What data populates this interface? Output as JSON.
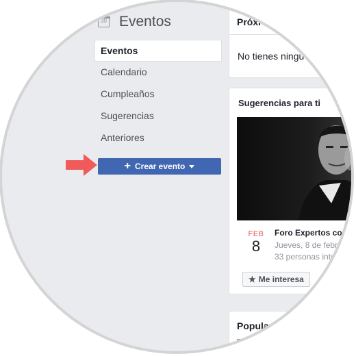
{
  "header": {
    "title": "Eventos",
    "calendar_icon_text": "30"
  },
  "sidebar": {
    "items": [
      {
        "label": "Eventos",
        "active": true
      },
      {
        "label": "Calendario"
      },
      {
        "label": "Cumpleaños"
      },
      {
        "label": "Sugerencias"
      },
      {
        "label": "Anteriores"
      }
    ],
    "create_button": {
      "label": "Crear evento"
    }
  },
  "upcoming": {
    "title": "Próxi",
    "empty_text": "No tienes ningu"
  },
  "suggestions": {
    "title": "Sugerencias para ti",
    "event": {
      "month": "FEB",
      "day": "8",
      "title": "Foro Expertos co",
      "date_text": "Jueves, 8 de febr",
      "people_text": "33 personas inte",
      "interest_label": "Me interesa"
    }
  },
  "popular": {
    "title": "Popular"
  },
  "colors": {
    "accent": "#4267b2",
    "arrow": "#f05a5a",
    "month": "#e65a4e"
  },
  "icons": [
    "calendar-icon",
    "plus-icon",
    "caret-down-icon",
    "star-icon",
    "pointer-arrow-icon"
  ]
}
